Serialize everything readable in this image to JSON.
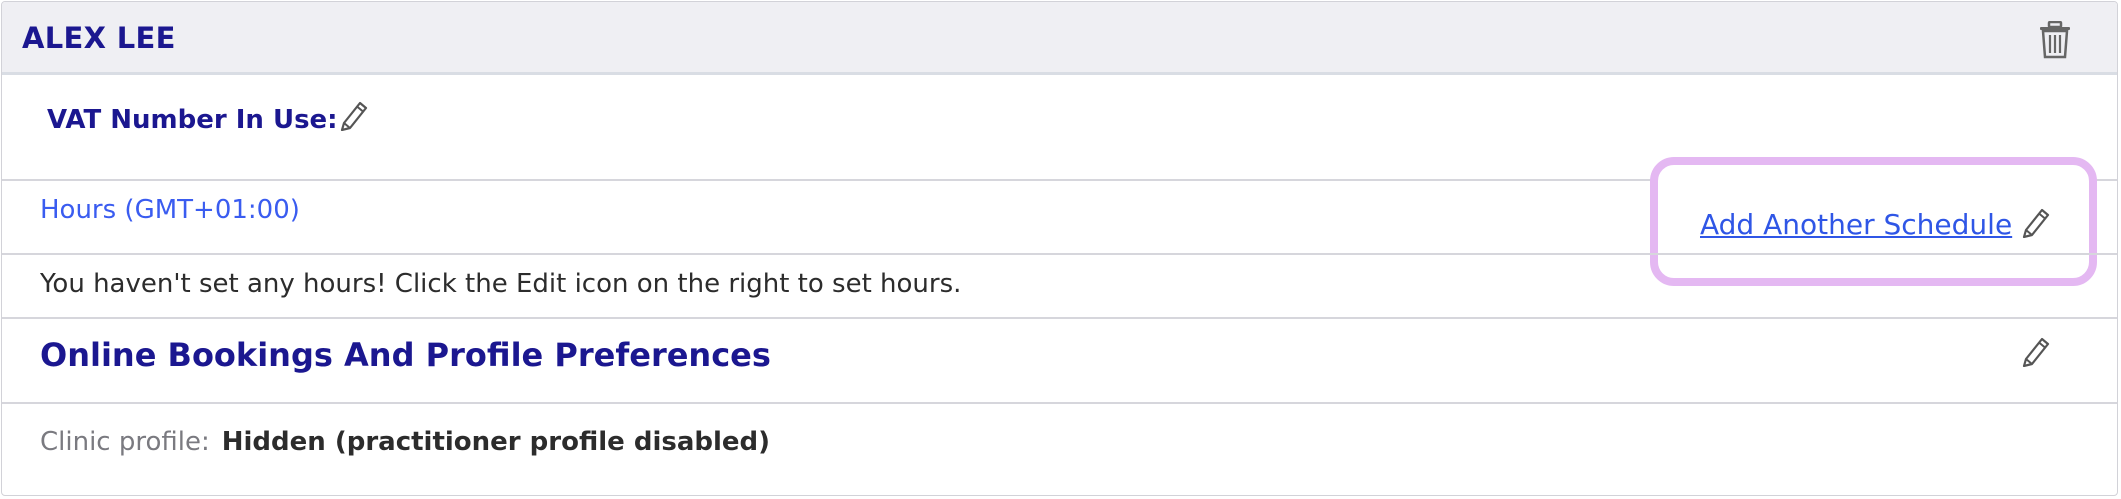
{
  "practitioner": {
    "name": "ALEX LEE"
  },
  "vat": {
    "label": "VAT Number In Use:",
    "value": ""
  },
  "hours": {
    "label": "Hours (GMT+01:00)",
    "add_schedule": "Add Another Schedule",
    "empty_message": "You haven't set any hours! Click the Edit icon on the right to set hours."
  },
  "preferences": {
    "title": "Online Bookings And Profile Preferences",
    "clinic_profile_label": "Clinic profile:",
    "clinic_profile_value": "Hidden (practitioner profile disabled)"
  },
  "icons": {
    "delete": "trash-icon",
    "edit": "pencil-icon"
  },
  "colors": {
    "heading": "#1b1790",
    "link": "#2f56e6",
    "highlight": "#e4b8f2",
    "header_bg": "#efeff3"
  }
}
